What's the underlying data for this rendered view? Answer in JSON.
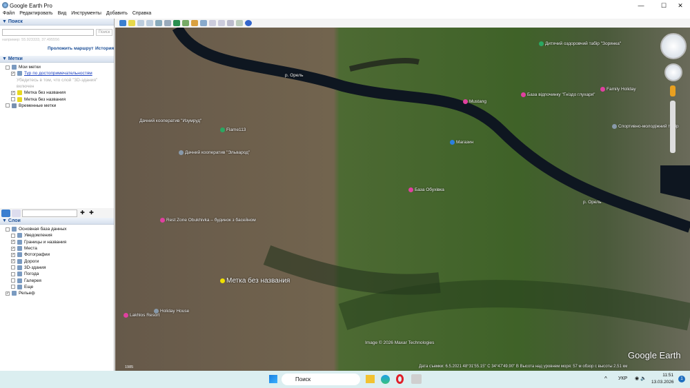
{
  "window": {
    "title": "Google Earth Pro",
    "minimize": "—",
    "maximize": "☐",
    "close": "✕"
  },
  "menu": [
    "Файл",
    "Редактировать",
    "Вид",
    "Инструменты",
    "Добавить",
    "Справка"
  ],
  "search": {
    "header": "Поиск",
    "button": "Поиск",
    "placeholder": "например: 55.923333, 37.495556",
    "route": "Проложить маршрут",
    "history": "История"
  },
  "places": {
    "header": "Метки",
    "items": [
      {
        "label": "Мои метки",
        "indent": 1,
        "checked": false
      },
      {
        "label": "Тур по достопримечательностям",
        "indent": 2,
        "checked": true,
        "link": true
      },
      {
        "label": "Убедитесь в том, что слой \"3D-здания\"",
        "indent": 3,
        "hint": true
      },
      {
        "label": "включен",
        "indent": 3,
        "hint": true
      },
      {
        "label": "Метка без названия",
        "indent": 2,
        "checked": true,
        "icon": "pushpin"
      },
      {
        "label": "Метка без названия",
        "indent": 2,
        "checked": false,
        "icon": "pushpin"
      },
      {
        "label": "Временные метки",
        "indent": 1,
        "checked": false,
        "icon": "folder"
      }
    ]
  },
  "layers": {
    "header": "Слои",
    "items": [
      {
        "label": "Основная база данных",
        "indent": 1,
        "checked": false
      },
      {
        "label": "Уведомления",
        "indent": 2,
        "checked": false
      },
      {
        "label": "Границы и названия",
        "indent": 2,
        "checked": true
      },
      {
        "label": "Места",
        "indent": 2,
        "checked": true
      },
      {
        "label": "Фотографии",
        "indent": 2,
        "checked": true
      },
      {
        "label": "Дороги",
        "indent": 2,
        "checked": true
      },
      {
        "label": "3D-здания",
        "indent": 2,
        "checked": false
      },
      {
        "label": "Погода",
        "indent": 2,
        "checked": false
      },
      {
        "label": "Галерея",
        "indent": 2,
        "checked": false
      },
      {
        "label": "Еще",
        "indent": 2,
        "checked": false
      },
      {
        "label": "Рельеф",
        "indent": 1,
        "checked": true
      }
    ]
  },
  "map": {
    "labels": [
      {
        "text": "р. Орель",
        "color": "#4a8fd0"
      },
      {
        "text": "р. Орель",
        "color": "#4a8fd0"
      },
      {
        "text": "Дачний кооператив \"Изумруд\"",
        "color": ""
      },
      {
        "text": "Flame113",
        "color": "#2aa862"
      },
      {
        "text": "Дачний кооператив \"Эльварод\"",
        "color": "#8899aa"
      },
      {
        "text": "Rest Zone Obukhivka – будинок з басейном",
        "color": "#e040a0"
      },
      {
        "text": "Holiday House",
        "color": "#8899aa"
      },
      {
        "text": "Lakhlos Resort",
        "color": "#e040a0"
      },
      {
        "text": "Магазин",
        "color": "#2a7fe0"
      },
      {
        "text": "База Обухівка",
        "color": "#e040a0"
      },
      {
        "text": "Дитячий оздоровчий табір \"Зорянка\"",
        "color": "#2aa862"
      },
      {
        "text": "База відпочинку \"Гніздо глухаря\"",
        "color": "#e040a0"
      },
      {
        "text": "Mustang",
        "color": "#e040a0"
      },
      {
        "text": "Family Holiday",
        "color": "#e040a0"
      },
      {
        "text": "Спортивно-молодіжний табір",
        "color": "#8899aa"
      },
      {
        "text": "Метка без названия",
        "color": "#f0e000"
      }
    ],
    "copyright": "Image © 2026 Maxar Technologies",
    "logo": "Google Earth",
    "year": "1985",
    "status": "Дата съемки: 6.5.2021    48°31'55.15\" С    34°47'49.90\" В  Высота над уровнем моря:  57 м    обзор с высоты  2.51 км"
  },
  "taskbar": {
    "search": "Поиск",
    "lang": "УКР",
    "time": "11:51",
    "date": "13.03.2026",
    "notif": "1"
  }
}
